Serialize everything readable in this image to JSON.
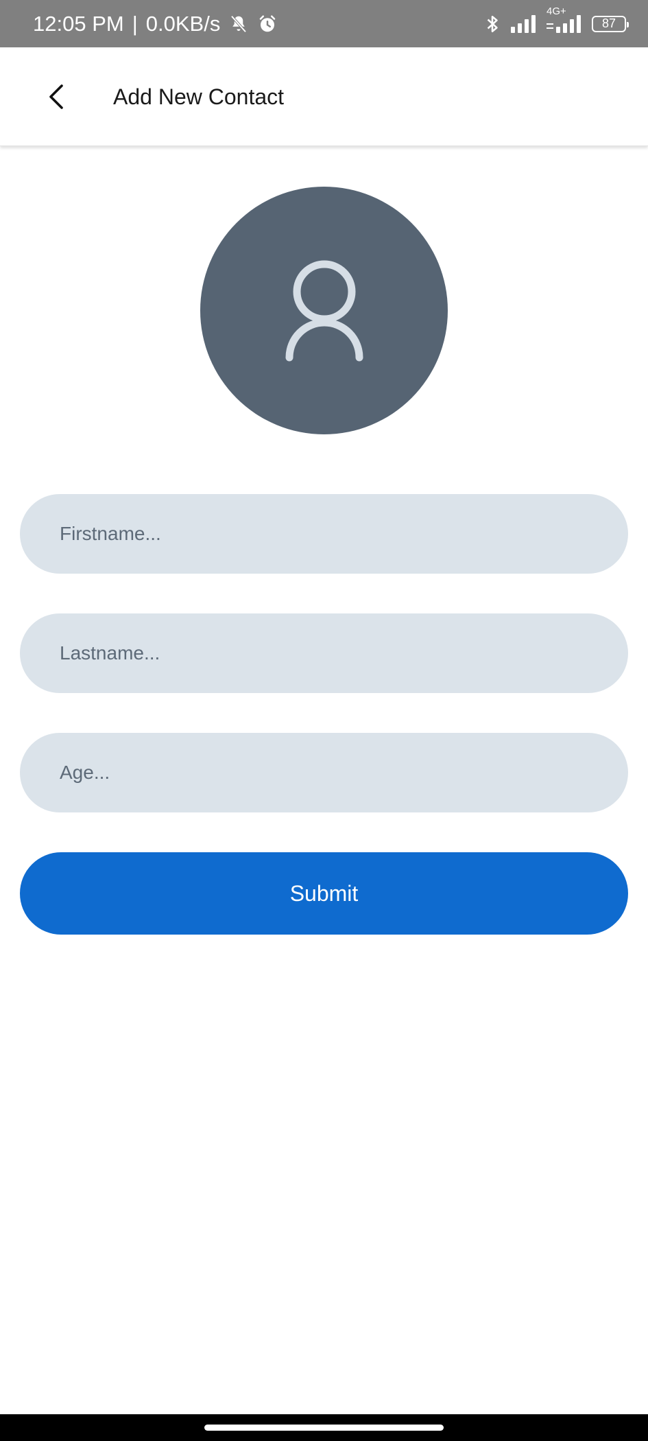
{
  "status_bar": {
    "time": "12:05 PM",
    "separator": "|",
    "net_speed": "0.0KB/s",
    "network_type": "4G+",
    "battery_level": "87",
    "icons": [
      "bell-muted-icon",
      "alarm-icon",
      "bluetooth-icon",
      "signal-icon",
      "signal-4g-icon",
      "battery-icon"
    ]
  },
  "header": {
    "back_icon": "chevron-left-icon",
    "title": "Add New Contact"
  },
  "avatar": {
    "icon": "person-icon",
    "bg_color": "#566473",
    "icon_color": "#d6dee6"
  },
  "form": {
    "firstname_placeholder": "Firstname...",
    "lastname_placeholder": "Lastname...",
    "age_placeholder": "Age...",
    "firstname_value": "",
    "lastname_value": "",
    "age_value": "",
    "submit_label": "Submit",
    "field_bg_color": "#dbe3ea",
    "submit_color": "#0f6bcf"
  }
}
